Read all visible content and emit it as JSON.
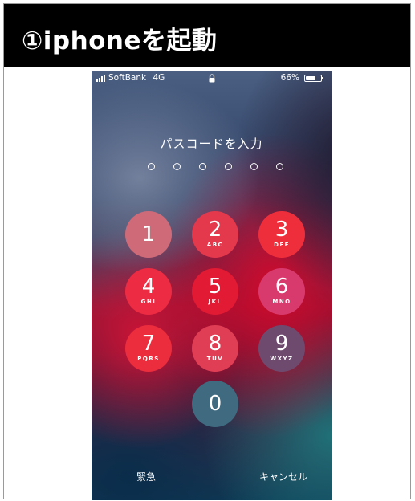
{
  "header": {
    "title": "①iphoneを起動"
  },
  "status_bar": {
    "carrier": "SoftBank",
    "network": "4G",
    "battery_percent": "66%",
    "battery_level": 0.66,
    "icons": [
      "signal-icon",
      "lock-icon",
      "battery-icon"
    ]
  },
  "lock_screen": {
    "prompt": "パスコードを入力",
    "passcode_length": 6,
    "keys": [
      {
        "digit": "1",
        "letters": "",
        "color": "#cf6b78"
      },
      {
        "digit": "2",
        "letters": "ABC",
        "color": "#e4384c"
      },
      {
        "digit": "3",
        "letters": "DEF",
        "color": "#ef2e3b"
      },
      {
        "digit": "4",
        "letters": "GHI",
        "color": "#ed2b43"
      },
      {
        "digit": "5",
        "letters": "JKL",
        "color": "#e21a34"
      },
      {
        "digit": "6",
        "letters": "MNO",
        "color": "#d93a6e"
      },
      {
        "digit": "7",
        "letters": "PQRS",
        "color": "#eb2d3d"
      },
      {
        "digit": "8",
        "letters": "TUV",
        "color": "#e03e55"
      },
      {
        "digit": "9",
        "letters": "WXYZ",
        "color": "#6f4a6f"
      },
      {
        "digit": "0",
        "letters": "",
        "color": "#3f6a80"
      }
    ],
    "emergency_label": "緊急",
    "cancel_label": "キャンセル"
  }
}
